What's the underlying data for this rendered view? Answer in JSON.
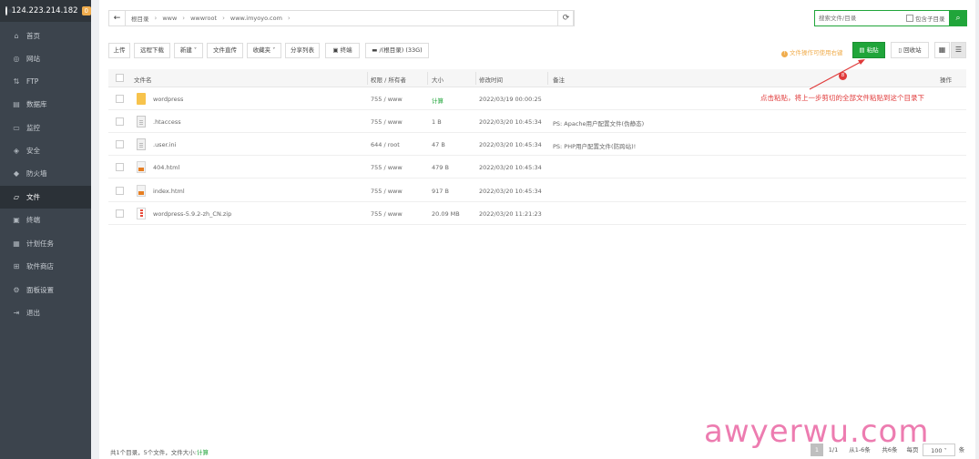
{
  "sidebar": {
    "ip": "124.223.214.182",
    "badge": "0",
    "items": [
      {
        "label": "首页",
        "icon": "home-icon"
      },
      {
        "label": "网站",
        "icon": "globe-icon"
      },
      {
        "label": "FTP",
        "icon": "ftp-icon"
      },
      {
        "label": "数据库",
        "icon": "database-icon"
      },
      {
        "label": "监控",
        "icon": "monitor-icon"
      },
      {
        "label": "安全",
        "icon": "shield-icon"
      },
      {
        "label": "防火墙",
        "icon": "firewall-icon"
      },
      {
        "label": "文件",
        "icon": "folder-icon"
      },
      {
        "label": "终端",
        "icon": "terminal-icon"
      },
      {
        "label": "计划任务",
        "icon": "calendar-icon"
      },
      {
        "label": "软件商店",
        "icon": "store-icon"
      },
      {
        "label": "面板设置",
        "icon": "settings-icon"
      },
      {
        "label": "退出",
        "icon": "logout-icon"
      }
    ],
    "active_index": 7
  },
  "path_bar": {
    "back": "←",
    "parts": [
      "根目录",
      "www",
      "wwwroot",
      "www.imyoyo.com"
    ],
    "sep": "›",
    "refresh": "⟳"
  },
  "search": {
    "placeholder": "搜索文件/目录",
    "subdir_label": "包含子目录",
    "button": "⌕"
  },
  "toolbar": {
    "upload": "上传",
    "remote_download": "远程下载",
    "new": "新建",
    "file_transfer": "文件直传",
    "favorites": "收藏夹",
    "share_list": "分享列表",
    "terminal": "终端",
    "disk": "/(根目录) (33G)",
    "warning": "文件操作可使用右键",
    "paste": "粘贴",
    "recycle": "回收站",
    "grid_view": "▦",
    "list_view": "☰"
  },
  "table": {
    "headers": {
      "name": "文件名",
      "perm": "权限 / 所有者",
      "size": "大小",
      "mtime": "修改时间",
      "note": "备注",
      "ops": "操作"
    },
    "rows": [
      {
        "name": "wordpress",
        "type": "folder",
        "perm": "755 / www",
        "size": "计算",
        "mtime": "2022/03/19 00:00:25",
        "note": ""
      },
      {
        "name": ".htaccess",
        "type": "doc",
        "perm": "755 / www",
        "size": "1 B",
        "mtime": "2022/03/20 10:45:34",
        "note": "PS: Apache用户配置文件(伪静态)"
      },
      {
        "name": ".user.ini",
        "type": "doc",
        "perm": "644 / root",
        "size": "47 B",
        "mtime": "2022/03/20 10:45:34",
        "note": "PS: PHP用户配置文件(防跨站)!"
      },
      {
        "name": "404.html",
        "type": "html",
        "perm": "755 / www",
        "size": "479 B",
        "mtime": "2022/03/20 10:45:34",
        "note": ""
      },
      {
        "name": "index.html",
        "type": "html",
        "perm": "755 / www",
        "size": "917 B",
        "mtime": "2022/03/20 10:45:34",
        "note": ""
      },
      {
        "name": "wordpress-5.9.2-zh_CN.zip",
        "type": "zip",
        "perm": "755 / www",
        "size": "20.09 MB",
        "mtime": "2022/03/20 11:21:23",
        "note": ""
      }
    ]
  },
  "annotation": {
    "number": "8",
    "text": "点击粘贴，将上一步剪切的全部文件粘贴到这个目录下"
  },
  "footer": {
    "summary": "共1个目录，5个文件，文件大小:",
    "calc": "计算",
    "page_current": "1",
    "page_total": "1/1",
    "range": "从1-6条",
    "count": "共6条",
    "per_page_label": "每页",
    "per_page": "100",
    "per_page_unit": "条"
  },
  "watermark": "awyerwu.com",
  "colors": {
    "accent": "#20a53a",
    "sidebar": "#3c444d",
    "annotation": "#e03a3a",
    "warning": "#f0ad4e"
  }
}
